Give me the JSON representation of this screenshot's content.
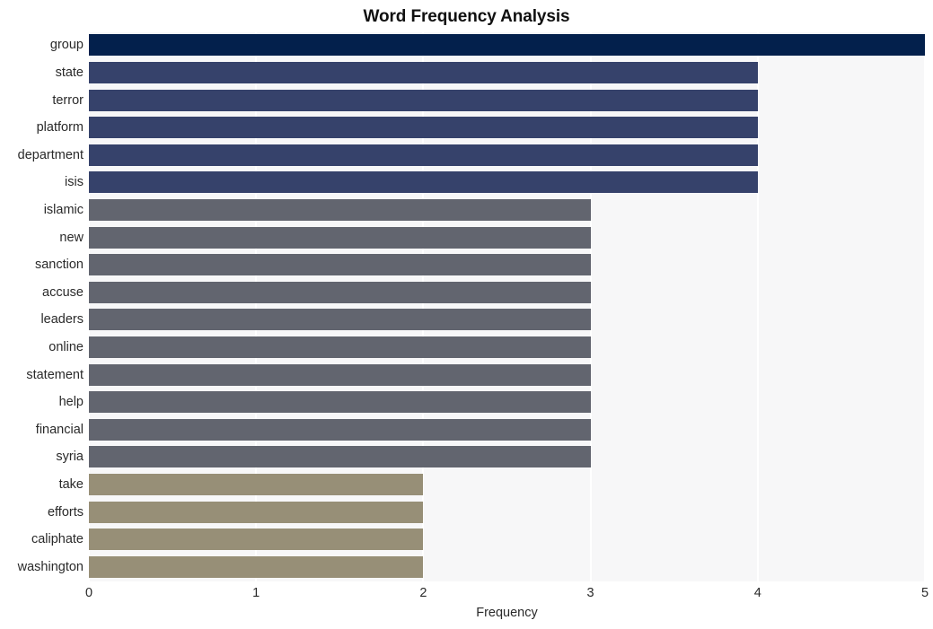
{
  "chart_data": {
    "type": "bar",
    "orientation": "horizontal",
    "title": "Word Frequency Analysis",
    "xlabel": "Frequency",
    "ylabel": "",
    "xlim": [
      0,
      5
    ],
    "xticks": [
      "0",
      "1",
      "2",
      "3",
      "4",
      "5"
    ],
    "grid": true,
    "legend": null,
    "categories": [
      "group",
      "state",
      "terror",
      "platform",
      "department",
      "isis",
      "islamic",
      "new",
      "sanction",
      "accuse",
      "leaders",
      "online",
      "statement",
      "help",
      "financial",
      "syria",
      "take",
      "efforts",
      "caliphate",
      "washington"
    ],
    "values": [
      5,
      4,
      4,
      4,
      4,
      4,
      3,
      3,
      3,
      3,
      3,
      3,
      3,
      3,
      3,
      3,
      2,
      2,
      2,
      2
    ],
    "bar_colors": [
      "#03204c",
      "#36426b",
      "#36426b",
      "#36426b",
      "#36426b",
      "#36426b",
      "#62656f",
      "#62656f",
      "#62656f",
      "#62656f",
      "#62656f",
      "#62656f",
      "#62656f",
      "#62656f",
      "#62656f",
      "#62656f",
      "#978f77",
      "#978f77",
      "#978f77",
      "#978f77"
    ],
    "plot_background": "#f7f7f8",
    "gridline_color": "#ffffff",
    "figure_background": "#ffffff"
  }
}
